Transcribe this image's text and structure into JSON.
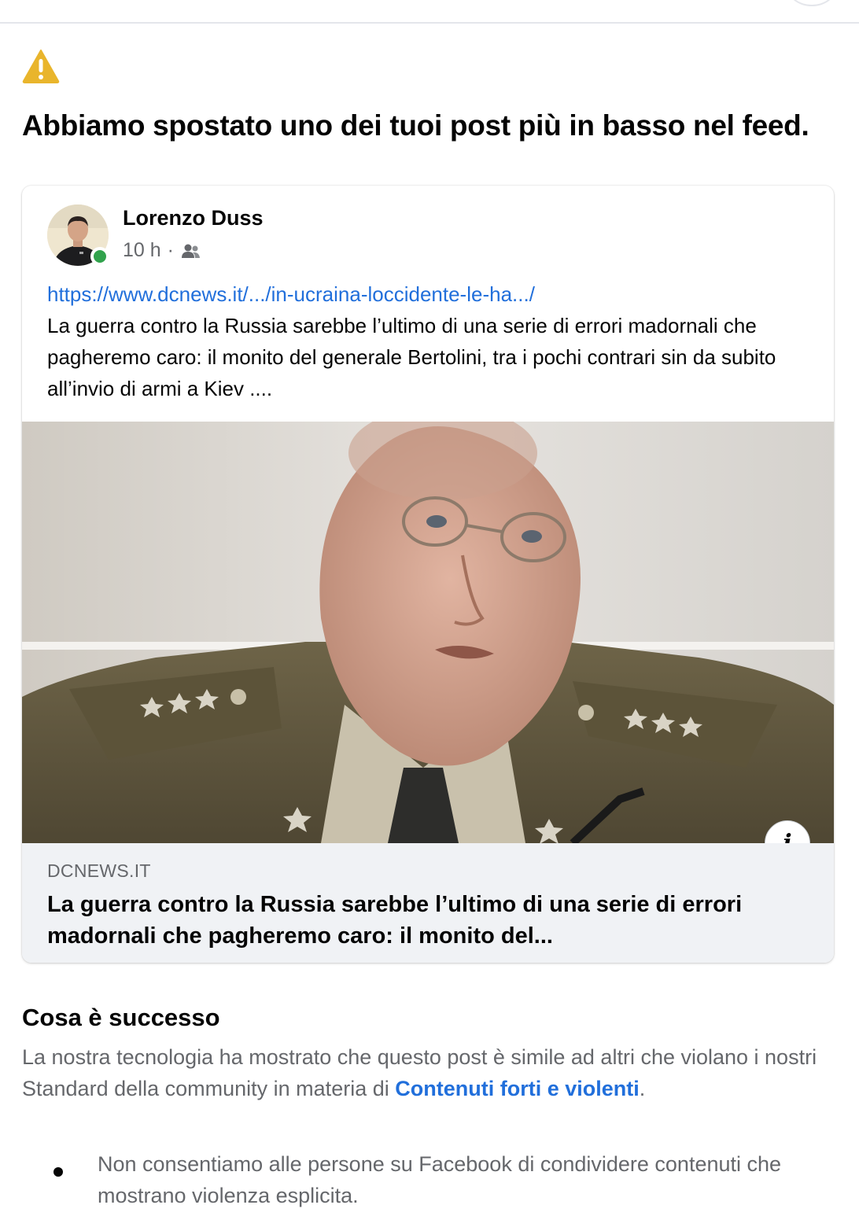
{
  "notice": {
    "icon": "warning-icon",
    "accent": "#e9b52c",
    "headline": "Abbiamo spostato uno dei tuoi post più in basso nel feed."
  },
  "post": {
    "author": "Lorenzo Duss",
    "time": "10 h",
    "separator": "·",
    "audience_icon": "friends-icon",
    "link": "https://www.dcnews.it/.../in-ucraina-loccidente-le-ha.../",
    "text": "La guerra contro la Russia sarebbe l’ultimo di una serie di errori madornali che pagheremo caro: il monito del generale Bertolini, tra i pochi contrari sin da subito all’invio di armi a Kiev ....",
    "preview": {
      "domain": "DCNEWS.IT",
      "title": "La guerra contro la Russia sarebbe l’ultimo di una serie di errori madornali che pagheremo caro: il monito del...",
      "info_label": "i"
    }
  },
  "details": {
    "title": "Cosa è successo",
    "text_before": "La nostra tecnologia ha mostrato che questo post è simile ad altri che violano i nostri Standard della community in materia di ",
    "link_text": "Contenuti forti e violenti",
    "text_after": ".",
    "bullets": [
      "Non consentiamo alle persone su Facebook di condividere contenuti che mostrano violenza esplicita."
    ]
  },
  "colors": {
    "link": "#216fdb",
    "secondary_text": "#65676b",
    "online": "#31a24c",
    "preview_bg": "#f0f2f5"
  }
}
